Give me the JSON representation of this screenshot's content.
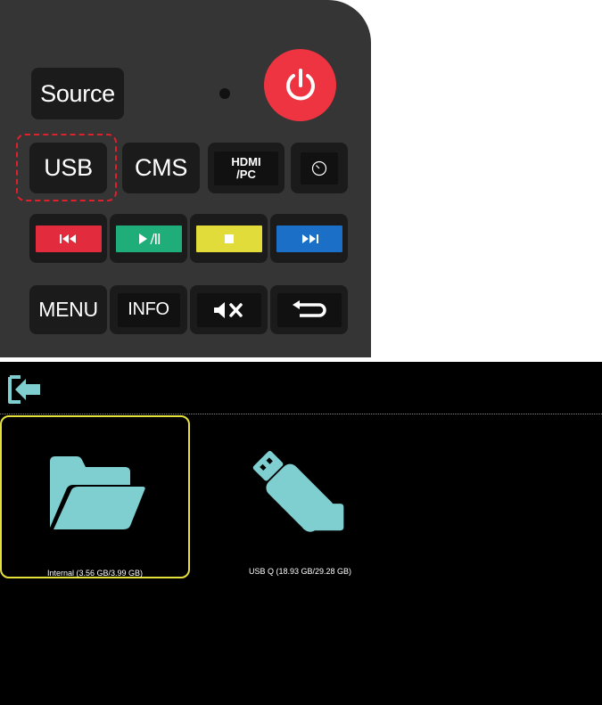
{
  "remote": {
    "buttons": {
      "source": "Source",
      "usb": "USB",
      "cms": "CMS",
      "hdmi": "HDMI\n/PC",
      "menu": "MENU",
      "info": "INFO"
    },
    "color_keys": {
      "prev": "#e22b3c",
      "play_pause": "#1fae7a",
      "stop": "#e2dc3a",
      "next": "#1b6fc6"
    },
    "power_color": "#ee3440",
    "highlight_color": "#e0202a"
  },
  "media_browser": {
    "accent_color": "#7fcfd1",
    "selected_border_color": "#e5e03c",
    "storage_items": [
      {
        "label": "Internal (3.56 GB/3.99 GB)",
        "icon": "folder-icon",
        "selected": true
      },
      {
        "label": "USB Q (18.93 GB/29.28 GB)",
        "icon": "usb-drive-icon",
        "selected": false
      }
    ]
  }
}
